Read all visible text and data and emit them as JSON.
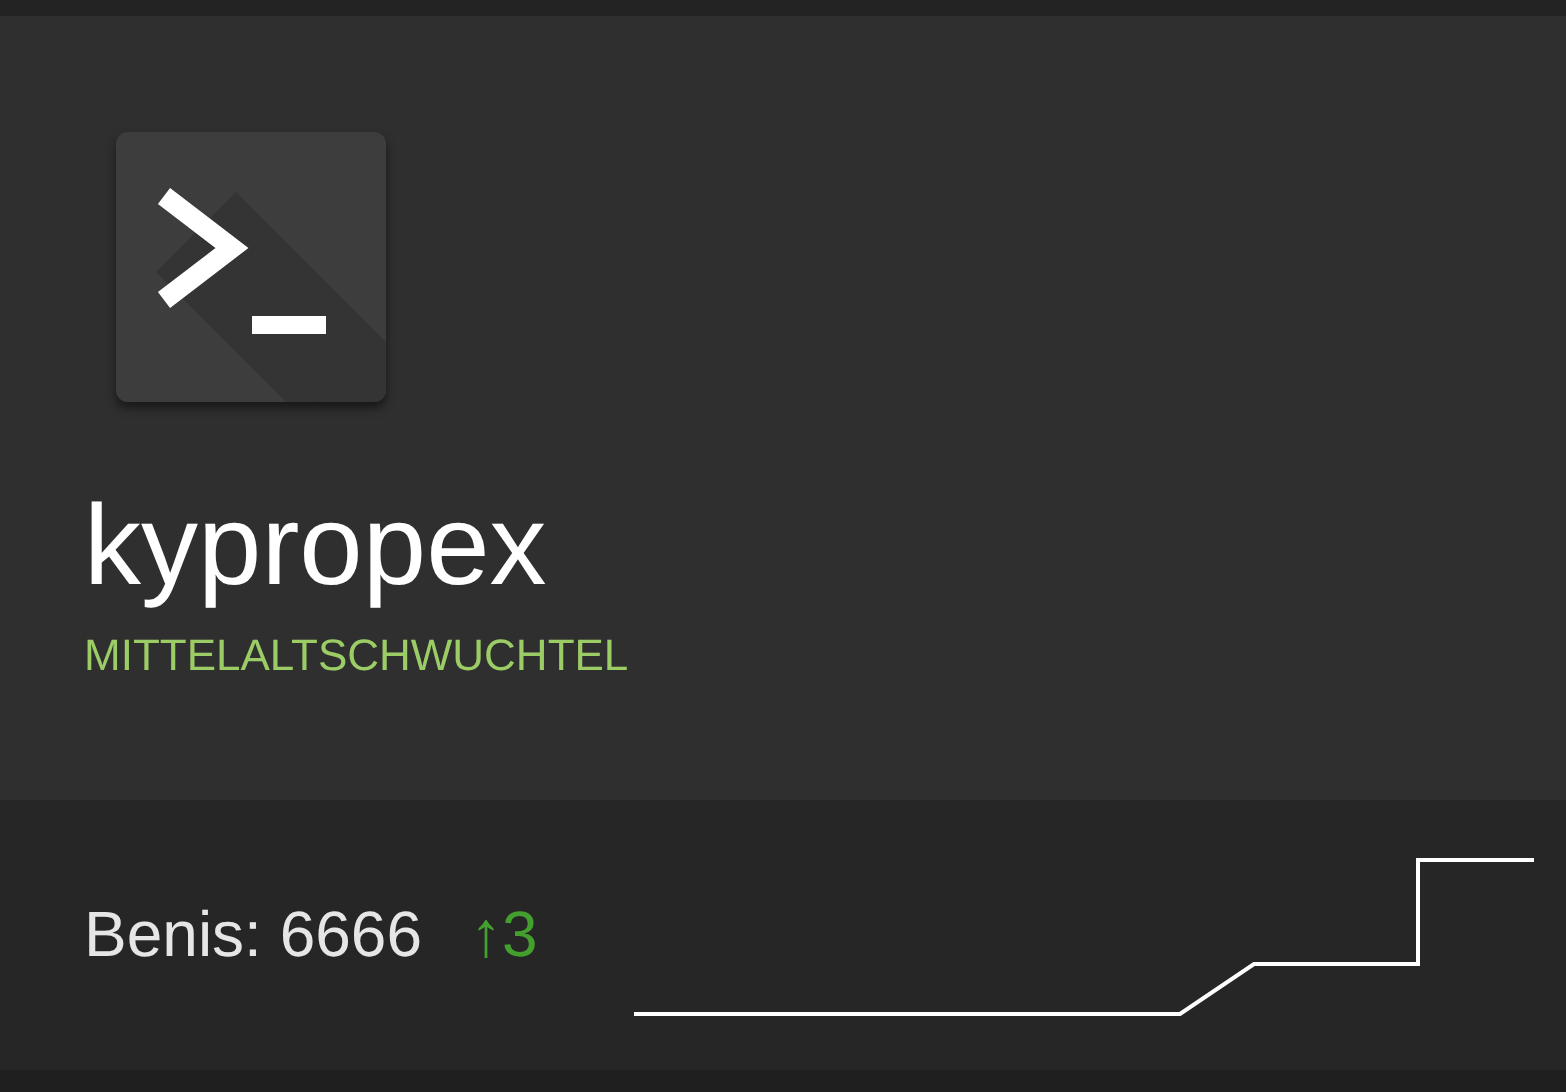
{
  "user": {
    "name": "kypropex",
    "rank": "MITTELALTSCHWUCHTEL"
  },
  "stats": {
    "benis": "Benis: 6666",
    "delta": "↑3"
  }
}
